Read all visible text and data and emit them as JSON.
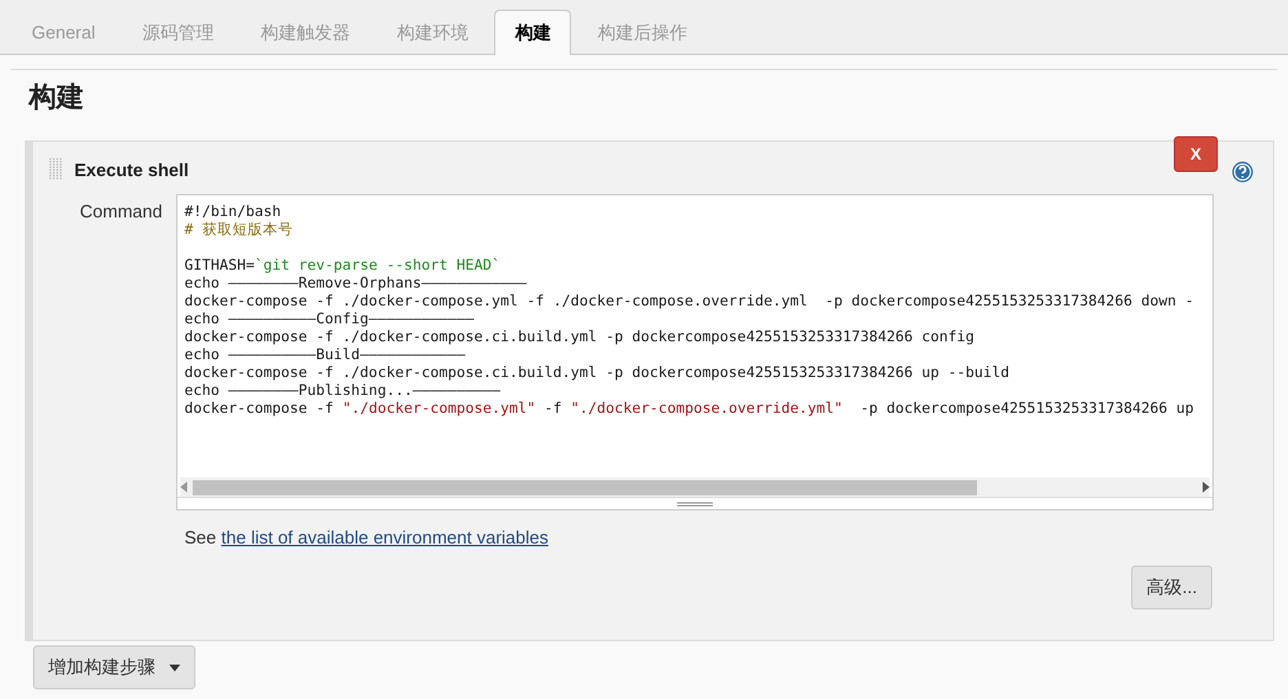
{
  "tabs": [
    {
      "label": "General",
      "selected": false
    },
    {
      "label": "源码管理",
      "selected": false
    },
    {
      "label": "构建触发器",
      "selected": false
    },
    {
      "label": "构建环境",
      "selected": false
    },
    {
      "label": "构建",
      "selected": true
    },
    {
      "label": "构建后操作",
      "selected": false
    }
  ],
  "section_title": "构建",
  "build_step": {
    "title": "Execute shell",
    "delete_button": "X",
    "command_label": "Command",
    "command_lines": [
      [
        {
          "kind": "plain",
          "text": "#!/bin/bash"
        }
      ],
      [
        {
          "kind": "comment",
          "text": "# 获取短版本号"
        }
      ],
      [
        {
          "kind": "blank"
        }
      ],
      [
        {
          "kind": "plain",
          "text": "GITHASH="
        },
        {
          "kind": "command",
          "text": "`git rev-parse --short HEAD`"
        }
      ],
      [
        {
          "kind": "plain",
          "text": "echo ————————Remove-Orphans————————————"
        }
      ],
      [
        {
          "kind": "plain",
          "text": "docker-compose -f ./docker-compose.yml -f ./docker-compose.override.yml  -p dockercompose4255153253317384266 down -"
        }
      ],
      [
        {
          "kind": "plain",
          "text": "echo ——————————Config————————————"
        }
      ],
      [
        {
          "kind": "plain",
          "text": "docker-compose -f ./docker-compose.ci.build.yml -p dockercompose4255153253317384266 config"
        }
      ],
      [
        {
          "kind": "plain",
          "text": "echo ——————————Build————————————"
        }
      ],
      [
        {
          "kind": "plain",
          "text": "docker-compose -f ./docker-compose.ci.build.yml -p dockercompose4255153253317384266 up --build"
        }
      ],
      [
        {
          "kind": "plain",
          "text": "echo ————————Publishing...——————————"
        }
      ],
      [
        {
          "kind": "plain",
          "text": "docker-compose -f "
        },
        {
          "kind": "string",
          "text": "\"./docker-compose.yml\""
        },
        {
          "kind": "plain",
          "text": " -f "
        },
        {
          "kind": "string",
          "text": "\"./docker-compose.override.yml\""
        },
        {
          "kind": "plain",
          "text": "  -p dockercompose4255153253317384266 up"
        }
      ]
    ],
    "see_text": "See",
    "env_link": "the list of available environment variables",
    "advanced_button": "高级..."
  },
  "add_step_button": "增加构建步骤"
}
